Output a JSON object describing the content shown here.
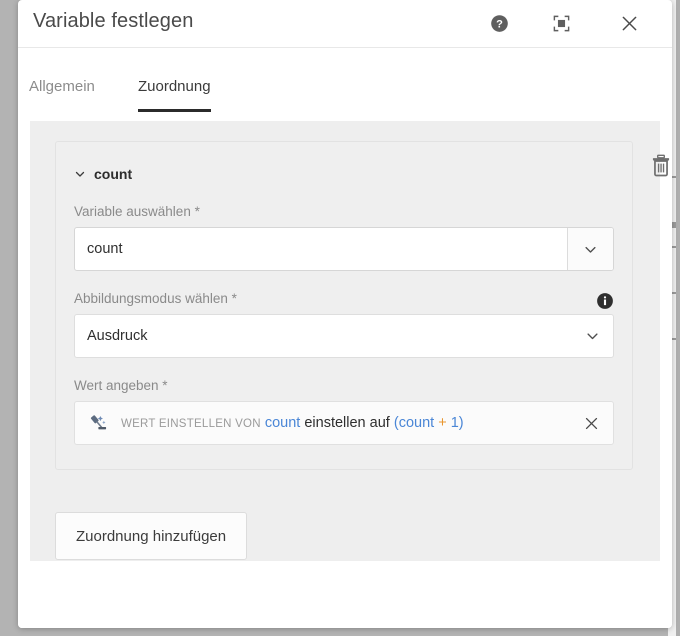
{
  "dialog": {
    "title": "Variable festlegen",
    "header_buttons": [
      {
        "name": "help-button",
        "icon": "help-circle-icon",
        "label": "?"
      },
      {
        "name": "maximize-button",
        "icon": "maximize-icon",
        "label": ""
      },
      {
        "name": "close-button",
        "icon": "close-icon",
        "label": "✕"
      }
    ]
  },
  "tabs": [
    {
      "label": "Allgemein",
      "active": false
    },
    {
      "label": "Zuordnung",
      "active": true
    }
  ],
  "assignment": {
    "title": "count",
    "collapse_icon": "chevron-down-icon",
    "delete_icon": "trash-icon",
    "variable": {
      "label": "Variable auswählen *",
      "value": "count",
      "placeholder": "Variable auswählen",
      "toggle_icon": "chevron-down-icon"
    },
    "mapping_mode": {
      "label": "Abbildungsmodus wählen *",
      "value": "Ausdruck",
      "info_icon": "info-icon",
      "toggle_icon": "chevron-down-icon",
      "options": [
        "Ausdruck"
      ]
    },
    "value": {
      "label": "Wert angeben *",
      "icon": "gavel-icon",
      "clear_icon": "close-icon",
      "expression_tokens": [
        {
          "text": "WERT EINSTELLEN VON",
          "type": "kw"
        },
        {
          "text": "count",
          "type": "var"
        },
        {
          "text": "einstellen auf",
          "type": "plain"
        },
        {
          "text": "(",
          "type": "punc"
        },
        {
          "text": "count",
          "type": "var"
        },
        {
          "text": "+",
          "type": "op"
        },
        {
          "text": "1",
          "type": "num"
        },
        {
          "text": ")",
          "type": "punc"
        }
      ],
      "expression_plain": "WERT EINSTELLEN VON count einstellen auf (count + 1)"
    }
  },
  "actions": {
    "add_assignment_label": "Zuordnung hinzufügen"
  },
  "colors": {
    "backdrop": "#b3b3b3",
    "body_bg": "#eeeeee",
    "variable_token": "#4a86d6",
    "operator_token": "#e8962e",
    "keyword_token": "#9a9a9a",
    "tab_active_underline": "#2b2b2b"
  }
}
